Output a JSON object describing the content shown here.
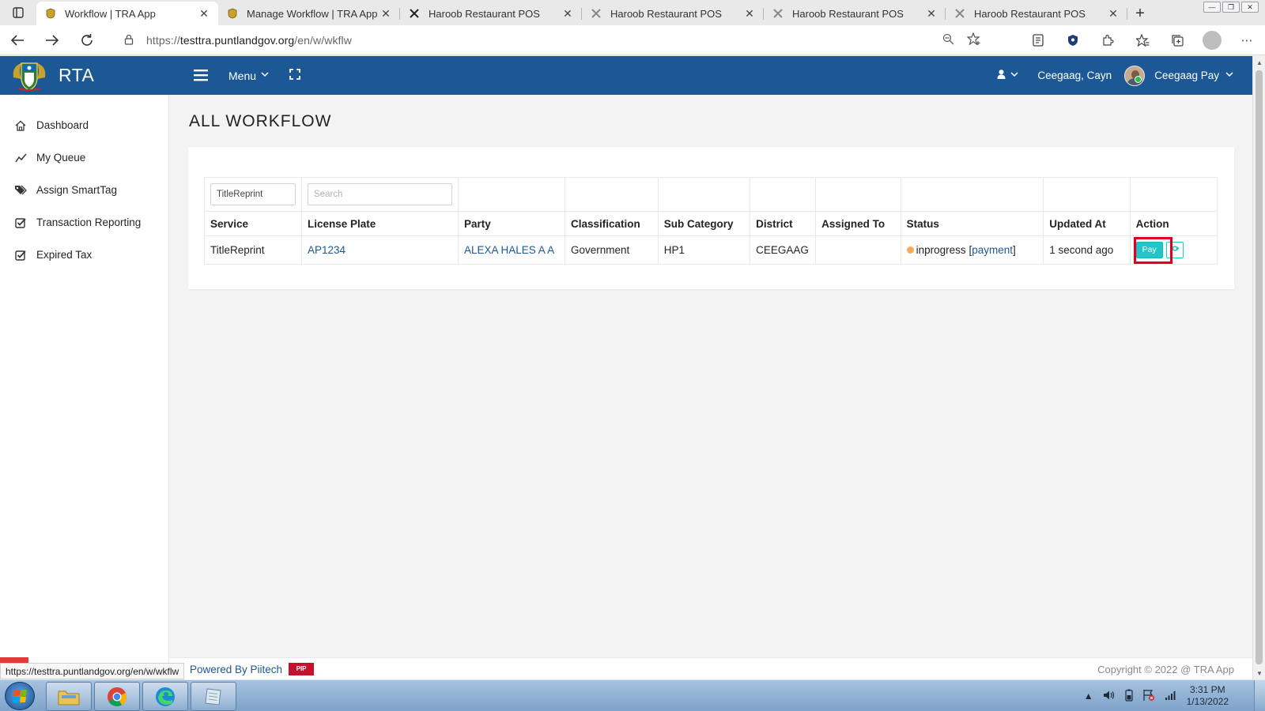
{
  "browser": {
    "tabs": [
      {
        "title": "Workflow | TRA App",
        "active": true,
        "icon": "crest-icon"
      },
      {
        "title": "Manage Workflow | TRA App",
        "active": false,
        "icon": "crest-icon"
      },
      {
        "title": "Haroob Restaurant POS",
        "active": false,
        "icon": "x-logo-icon"
      },
      {
        "title": "Haroob Restaurant POS",
        "active": false,
        "icon": "x-logo-icon"
      },
      {
        "title": "Haroob Restaurant POS",
        "active": false,
        "icon": "x-logo-icon"
      },
      {
        "title": "Haroob Restaurant POS",
        "active": false,
        "icon": "x-logo-icon"
      }
    ],
    "url_scheme": "https://",
    "url_host": "testtra.puntlandgov.org",
    "url_path": "/en/w/wkflw",
    "status_url": "https://testtra.puntlandgov.org/en/w/wkflw"
  },
  "header": {
    "brand": "RTA",
    "menu_label": "Menu",
    "user_name": "Ceegaag, Cayn",
    "account_name": "Ceegaag Pay",
    "bg_color": "#1b5895"
  },
  "sidebar": {
    "items": [
      {
        "label": "Dashboard",
        "icon": "home-icon"
      },
      {
        "label": "My Queue",
        "icon": "line-chart-icon"
      },
      {
        "label": "Assign SmartTag",
        "icon": "tags-icon"
      },
      {
        "label": "Transaction Reporting",
        "icon": "check-square-icon"
      },
      {
        "label": "Expired Tax",
        "icon": "check-square-icon"
      }
    ]
  },
  "main": {
    "title": "ALL WORKFLOW",
    "filters": {
      "service_value": "TitleReprint",
      "search_placeholder": "Search"
    },
    "columns": [
      "Service",
      "License Plate",
      "Party",
      "Classification",
      "Sub Category",
      "District",
      "Assigned To",
      "Status",
      "Updated At",
      "Action"
    ],
    "rows": [
      {
        "service": "TitleReprint",
        "license_plate": "AP1234",
        "party": "ALEXA HALES A A",
        "classification": "Government",
        "sub_category": "HP1",
        "district": "CEEGAAG",
        "assigned_to": "",
        "status": "inprogress",
        "status_stage": "payment",
        "updated_at": "1 second ago",
        "pay_label": "Pay"
      }
    ]
  },
  "footer": {
    "powered_by": "Powered By Piitech",
    "piitech_logo_text": "PIP",
    "copyright": "Copyright © 2022 @ TRA App"
  },
  "taskbar": {
    "time": "3:31 PM",
    "date": "1/13/2022"
  }
}
